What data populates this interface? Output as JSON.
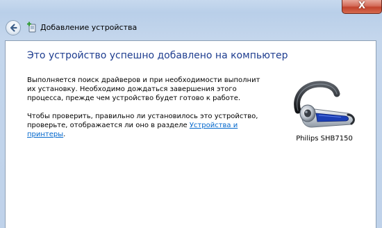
{
  "window": {
    "close_glyph": "X",
    "title": "Добавление устройства",
    "title_icon": "add-device-icon"
  },
  "main": {
    "heading": "Это устройство успешно добавлено на компьютер",
    "paragraph1": "Выполняется поиск драйверов и при необходимости выполнит их установку. Необходимо дождаться завершения этого процесса, прежде чем устройство будет готово к работе.",
    "paragraph2_prefix": "Чтобы проверить, правильно ли установилось это устройство, проверьте, отображается ли оно в разделе ",
    "paragraph2_link": "Устройства и принтеры",
    "paragraph2_suffix": "."
  },
  "device": {
    "name": "Philips SHB7150",
    "icon": "bluetooth-headset-icon"
  },
  "colors": {
    "heading": "#1e3d8f",
    "link": "#0066cc",
    "close_button": "#c7432d"
  }
}
